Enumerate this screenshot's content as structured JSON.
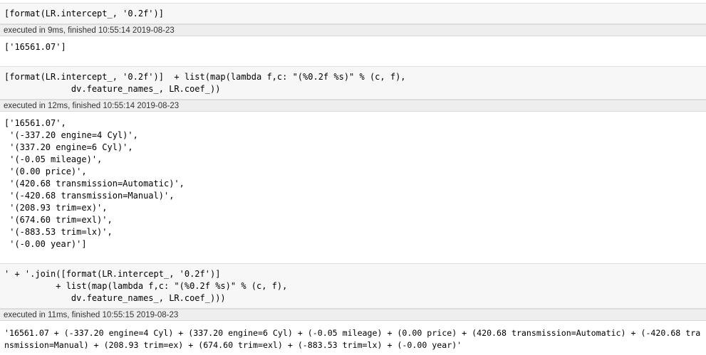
{
  "cells": [
    {
      "input_lines": [
        "[format(LR.intercept_, '0.2f')]"
      ],
      "exec_status": "executed in 9ms, finished 10:55:14 2019-08-23",
      "output_lines": [
        "['16561.07']"
      ]
    },
    {
      "input_lines": [
        "[format(LR.intercept_, '0.2f')]  + list(map(lambda f,c: \"(%0.2f %s)\" % (c, f),",
        "             dv.feature_names_, LR.coef_))"
      ],
      "exec_status": "executed in 12ms, finished 10:55:14 2019-08-23",
      "output_lines": [
        "['16561.07',",
        " '(-337.20 engine=4 Cyl)',",
        " '(337.20 engine=6 Cyl)',",
        " '(-0.05 mileage)',",
        " '(0.00 price)',",
        " '(420.68 transmission=Automatic)',",
        " '(-420.68 transmission=Manual)',",
        " '(208.93 trim=ex)',",
        " '(674.60 trim=exl)',",
        " '(-883.53 trim=lx)',",
        " '(-0.00 year)']"
      ]
    },
    {
      "input_lines": [
        "' + '.join([format(LR.intercept_, '0.2f')]",
        "          + list(map(lambda f,c: \"(%0.2f %s)\" % (c, f),",
        "             dv.feature_names_, LR.coef_)))"
      ],
      "exec_status": "executed in 11ms, finished 10:55:15 2019-08-23",
      "output_lines": [
        "'16561.07 + (-337.20 engine=4 Cyl) + (337.20 engine=6 Cyl) + (-0.05 mileage) + (0.00 price) + (420.68 transmission=Automatic) + (-420.68 tra",
        "nsmission=Manual) + (208.93 trim=ex) + (674.60 trim=exl) + (-883.53 trim=lx) + (-0.00 year)'"
      ]
    }
  ]
}
